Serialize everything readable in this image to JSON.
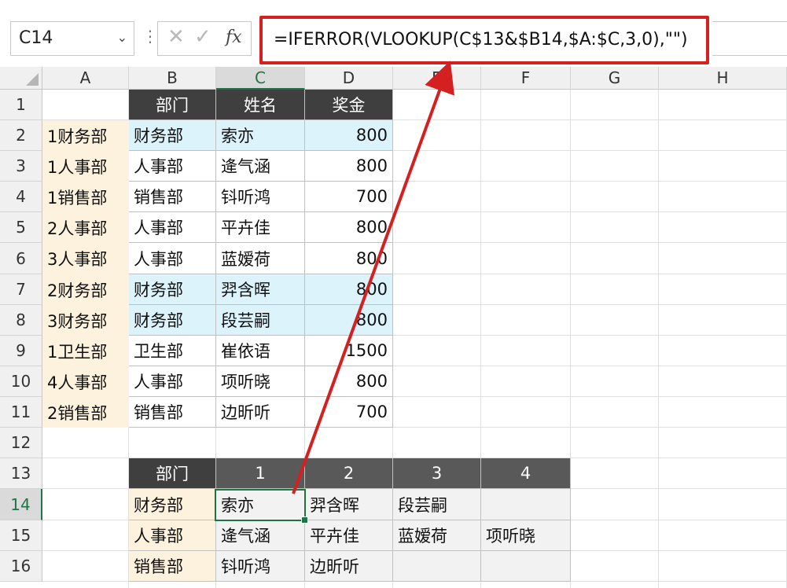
{
  "name_box": {
    "value": "C14"
  },
  "formula": {
    "text": "=IFERROR(VLOOKUP(C$13&$B14,$A:$C,3,0),\"\")"
  },
  "icons": {
    "cancel": "close-icon",
    "enter": "check-icon",
    "fx": "fx"
  },
  "fx_label": "fx",
  "columns": [
    "A",
    "B",
    "C",
    "D",
    "E",
    "F",
    "G",
    "H"
  ],
  "rows": [
    "1",
    "2",
    "3",
    "4",
    "5",
    "6",
    "7",
    "8",
    "9",
    "10",
    "11",
    "12",
    "13",
    "14",
    "15",
    "16"
  ],
  "table1": {
    "headers": [
      "部门",
      "姓名",
      "奖金"
    ],
    "rows": [
      {
        "key": "1财务部",
        "dept": "财务部",
        "name": "索亦",
        "bonus": "800"
      },
      {
        "key": "1人事部",
        "dept": "人事部",
        "name": "逄气涵",
        "bonus": "800"
      },
      {
        "key": "1销售部",
        "dept": "销售部",
        "name": "钭听鸿",
        "bonus": "700"
      },
      {
        "key": "2人事部",
        "dept": "人事部",
        "name": "平卉佳",
        "bonus": "800"
      },
      {
        "key": "3人事部",
        "dept": "人事部",
        "name": "蓝嫒荷",
        "bonus": "800"
      },
      {
        "key": "2财务部",
        "dept": "财务部",
        "name": "羿含晖",
        "bonus": "800"
      },
      {
        "key": "3财务部",
        "dept": "财务部",
        "name": "段芸嗣",
        "bonus": "800"
      },
      {
        "key": "1卫生部",
        "dept": "卫生部",
        "name": "崔依语",
        "bonus": "1500"
      },
      {
        "key": "4人事部",
        "dept": "人事部",
        "name": "项听晓",
        "bonus": "800"
      },
      {
        "key": "2销售部",
        "dept": "销售部",
        "name": "边昕听",
        "bonus": "700"
      }
    ]
  },
  "table2": {
    "headers": [
      "部门",
      "1",
      "2",
      "3",
      "4"
    ],
    "rows": [
      [
        "财务部",
        "索亦",
        "羿含晖",
        "段芸嗣",
        ""
      ],
      [
        "人事部",
        "逄气涵",
        "平卉佳",
        "蓝嫒荷",
        "项听晓"
      ],
      [
        "销售部",
        "钭听鸿",
        "边昕听",
        "",
        ""
      ]
    ]
  },
  "colors": {
    "annotation": "#d42020",
    "selection": "#217346",
    "header_dark": "#3f3f3f",
    "key_bg": "#fcf2de",
    "highlight_bg": "#ddf3fb"
  }
}
